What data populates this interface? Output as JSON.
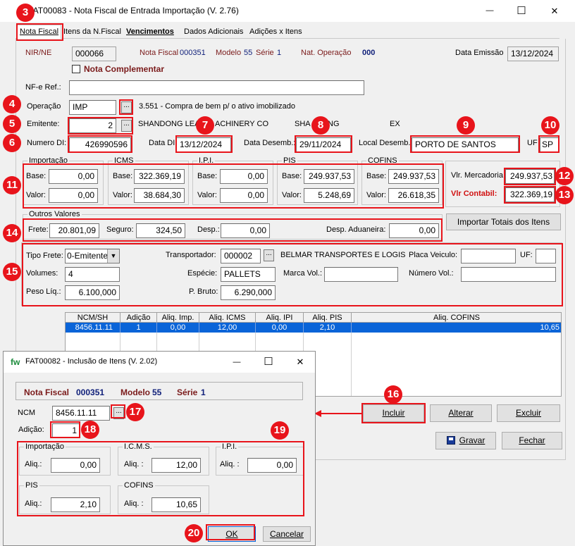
{
  "main_window": {
    "title": "FAT00083 - Nota Fiscal de Entrada Importação (V. 2.76)",
    "tabs": [
      "Nota Fiscal",
      "Itens da N.Fiscal",
      "Vencimentos",
      "Dados Adicionais",
      "Adições x Itens"
    ],
    "nir_label": "NIR/NE",
    "nir_value": "000066",
    "nota_fiscal_label": "Nota Fiscal",
    "nota_fiscal_value": "000351",
    "modelo_label": "Modelo",
    "modelo_value": "55",
    "serie_label": "Série",
    "serie_value": "1",
    "nat_operacao_label": "Nat. Operação",
    "nat_operacao_value": "000",
    "data_emissao_label": "Data Emissão",
    "data_emissao_value": "13/12/2024",
    "nota_complementar_label": "Nota Complementar",
    "nfe_ref_label": "NF-e Ref.:",
    "nfe_ref_value": "",
    "operacao_label": "Operação",
    "operacao_value": "IMP",
    "operacao_desc": "3.551 - Compra de bem p/ o ativo imobilizado",
    "emitente_label": "Emitente:",
    "emitente_value": "2",
    "emitente_name": "SHANDONG LEA",
    "emitente_name_cont": "ACHINERY CO",
    "emitente_city_a": "SHA",
    "emitente_city_b": "NG",
    "emitente_country": "EX",
    "numero_di_label": "Numero DI:",
    "numero_di_value": "426990596",
    "data_di_label": "Data DI:",
    "data_di_value": "13/12/2024",
    "data_desemb_label": "Data Desemb.:",
    "data_desemb_value": "29/11/2024",
    "local_desemb_label": "Local Desemb.:",
    "local_desemb_value": "PORTO DE SANTOS",
    "uf_label": "UF",
    "uf_value": "SP",
    "base_label": "Base:",
    "valor_label": "Valor:",
    "groups": [
      {
        "title": "Importação",
        "base": "0,00",
        "valor": "0,00"
      },
      {
        "title": "ICMS",
        "base": "322.369,19",
        "valor": "38.684,30"
      },
      {
        "title": "I.P.I.",
        "base": "0,00",
        "valor": "0,00"
      },
      {
        "title": "PIS",
        "base": "249.937,53",
        "valor": "5.248,69"
      },
      {
        "title": "COFINS",
        "base": "249.937,53",
        "valor": "26.618,35"
      }
    ],
    "vlr_mercadoria_label": "Vlr. Mercadoria:",
    "vlr_mercadoria_value": "249.937,53",
    "vlr_contabil_label": "Vlr Contabil:",
    "vlr_contabil_value": "322.369,19",
    "outros_valores_title": "Outros Valores",
    "frete_label": "Frete:",
    "frete_value": "20.801,09",
    "seguro_label": "Seguro:",
    "seguro_value": "324,50",
    "desp_label": "Desp.:",
    "desp_value": "0,00",
    "desp_aduaneira_label": "Desp. Aduaneira:",
    "desp_aduaneira_value": "0,00",
    "importar_totais_label": "Importar Totais dos Itens",
    "tipo_frete_label": "Tipo Frete:",
    "tipo_frete_value": "0-Emitente",
    "transportador_label": "Transportador:",
    "transportador_value": "000002",
    "transportador_name": "BELMAR TRANSPORTES E LOGIS",
    "placa_label": "Placa Veiculo:",
    "placa_value": "",
    "uf2_label": "UF:",
    "uf2_value": "",
    "volumes_label": "Volumes:",
    "volumes_value": "4",
    "especie_label": "Espécie:",
    "especie_value": "PALLETS",
    "marca_label": "Marca Vol.:",
    "marca_value": "",
    "numero_vol_label": "Número Vol.:",
    "numero_vol_value": "",
    "peso_liq_label": "Peso Líq.:",
    "peso_liq_value": "6.100,000",
    "peso_bruto_label": "P. Bruto:",
    "peso_bruto_value": "6.290,000",
    "grid_headers": [
      "NCM/SH",
      "Adição",
      "Aliq. Imp.",
      "Aliq. ICMS",
      "Aliq. IPI",
      "Aliq. PIS",
      "Aliq. COFINS"
    ],
    "grid_row": [
      "8456.11.11",
      "1",
      "0,00",
      "12,00",
      "0,00",
      "2,10",
      "10,65"
    ],
    "incluir_label": "Incluir",
    "alterar_label": "Alterar",
    "excluir_label": "Excluir",
    "gravar_label": "Gravar",
    "fechar_label": "Fechar"
  },
  "dialog": {
    "title": "FAT00082 - Inclusão de Itens (V. 2.02)",
    "app_icon_text": "fw",
    "nota_fiscal_label": "Nota Fiscal",
    "nota_fiscal_value": "000351",
    "modelo_label": "Modelo",
    "modelo_value": "55",
    "serie_label": "Série",
    "serie_value": "1",
    "ncm_label": "NCM",
    "ncm_value": "8456.11.11",
    "adicao_label": "Adição:",
    "adicao_value": "1",
    "aliq_label": "Aliq.:",
    "aliq_label2": "Aliq. :",
    "groups": [
      {
        "title": "Importação",
        "aliq": "0,00"
      },
      {
        "title": "I.C.M.S.",
        "aliq": "12,00"
      },
      {
        "title": "I.P.I.",
        "aliq": "0,00"
      },
      {
        "title": "PIS",
        "aliq": "2,10"
      },
      {
        "title": "COFINS",
        "aliq": "10,65"
      }
    ],
    "ok_label": "OK",
    "cancelar_label": "Cancelar"
  },
  "window_controls": {
    "minimize": "—",
    "maximize": "☐",
    "close": "✕"
  },
  "badges": [
    "3",
    "4",
    "5",
    "6",
    "7",
    "8",
    "9",
    "10",
    "11",
    "12",
    "13",
    "14",
    "15",
    "16",
    "17",
    "18",
    "19",
    "20"
  ],
  "colors": {
    "highlight": "#e8141b",
    "selection": "#0a64d8",
    "dark_red": "#7a1a1a",
    "navy": "#10207a"
  }
}
